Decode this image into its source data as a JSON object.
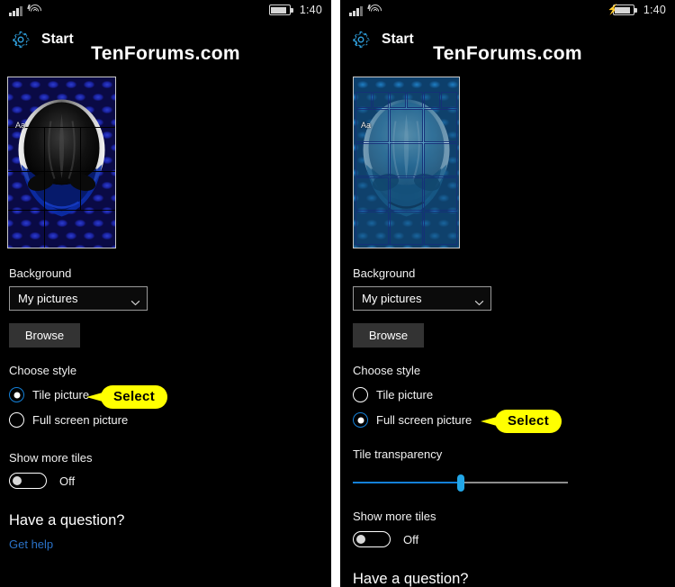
{
  "page": {
    "watermark": "TenForums.com",
    "accent_blue": "#1480d8",
    "callout_yellow": "#ffff00",
    "link_blue": "#2a72c8"
  },
  "left_phone": {
    "status_bar": {
      "signal_icon": "cellular-signal-icon",
      "wifi_icon": "wifi-icon",
      "battery_icon": "battery-icon",
      "clock": "1:40"
    },
    "header": {
      "gear_icon": "gear-icon",
      "title": "Start"
    },
    "preview": {
      "tile_text": "Aa",
      "style": "tile-picture-preview"
    },
    "background": {
      "label": "Background",
      "dropdown_value": "My pictures",
      "dropdown_chevron": "chevron-down-icon",
      "browse_label": "Browse"
    },
    "choose_style": {
      "label": "Choose style",
      "options": [
        {
          "label": "Tile picture",
          "selected": true
        },
        {
          "label": "Full screen picture",
          "selected": false
        }
      ]
    },
    "show_more_tiles": {
      "label": "Show more tiles",
      "value": "Off"
    },
    "help": {
      "heading": "Have a question?",
      "link": "Get help"
    },
    "callout": {
      "text": "Select"
    }
  },
  "right_phone": {
    "status_bar": {
      "signal_icon": "cellular-signal-icon",
      "wifi_icon": "wifi-icon",
      "battery_icon": "battery-charging-icon",
      "clock": "1:40"
    },
    "header": {
      "gear_icon": "gear-icon",
      "title": "Start"
    },
    "preview": {
      "tile_text": "Aa",
      "style": "full-screen-picture-preview"
    },
    "background": {
      "label": "Background",
      "dropdown_value": "My pictures",
      "dropdown_chevron": "chevron-down-icon",
      "browse_label": "Browse"
    },
    "choose_style": {
      "label": "Choose style",
      "options": [
        {
          "label": "Tile picture",
          "selected": false
        },
        {
          "label": "Full screen picture",
          "selected": true
        }
      ]
    },
    "tile_transparency": {
      "label": "Tile transparency",
      "value_percent": 50
    },
    "show_more_tiles": {
      "label": "Show more tiles",
      "value": "Off"
    },
    "help": {
      "heading": "Have a question?"
    },
    "callout": {
      "text": "Select"
    }
  }
}
